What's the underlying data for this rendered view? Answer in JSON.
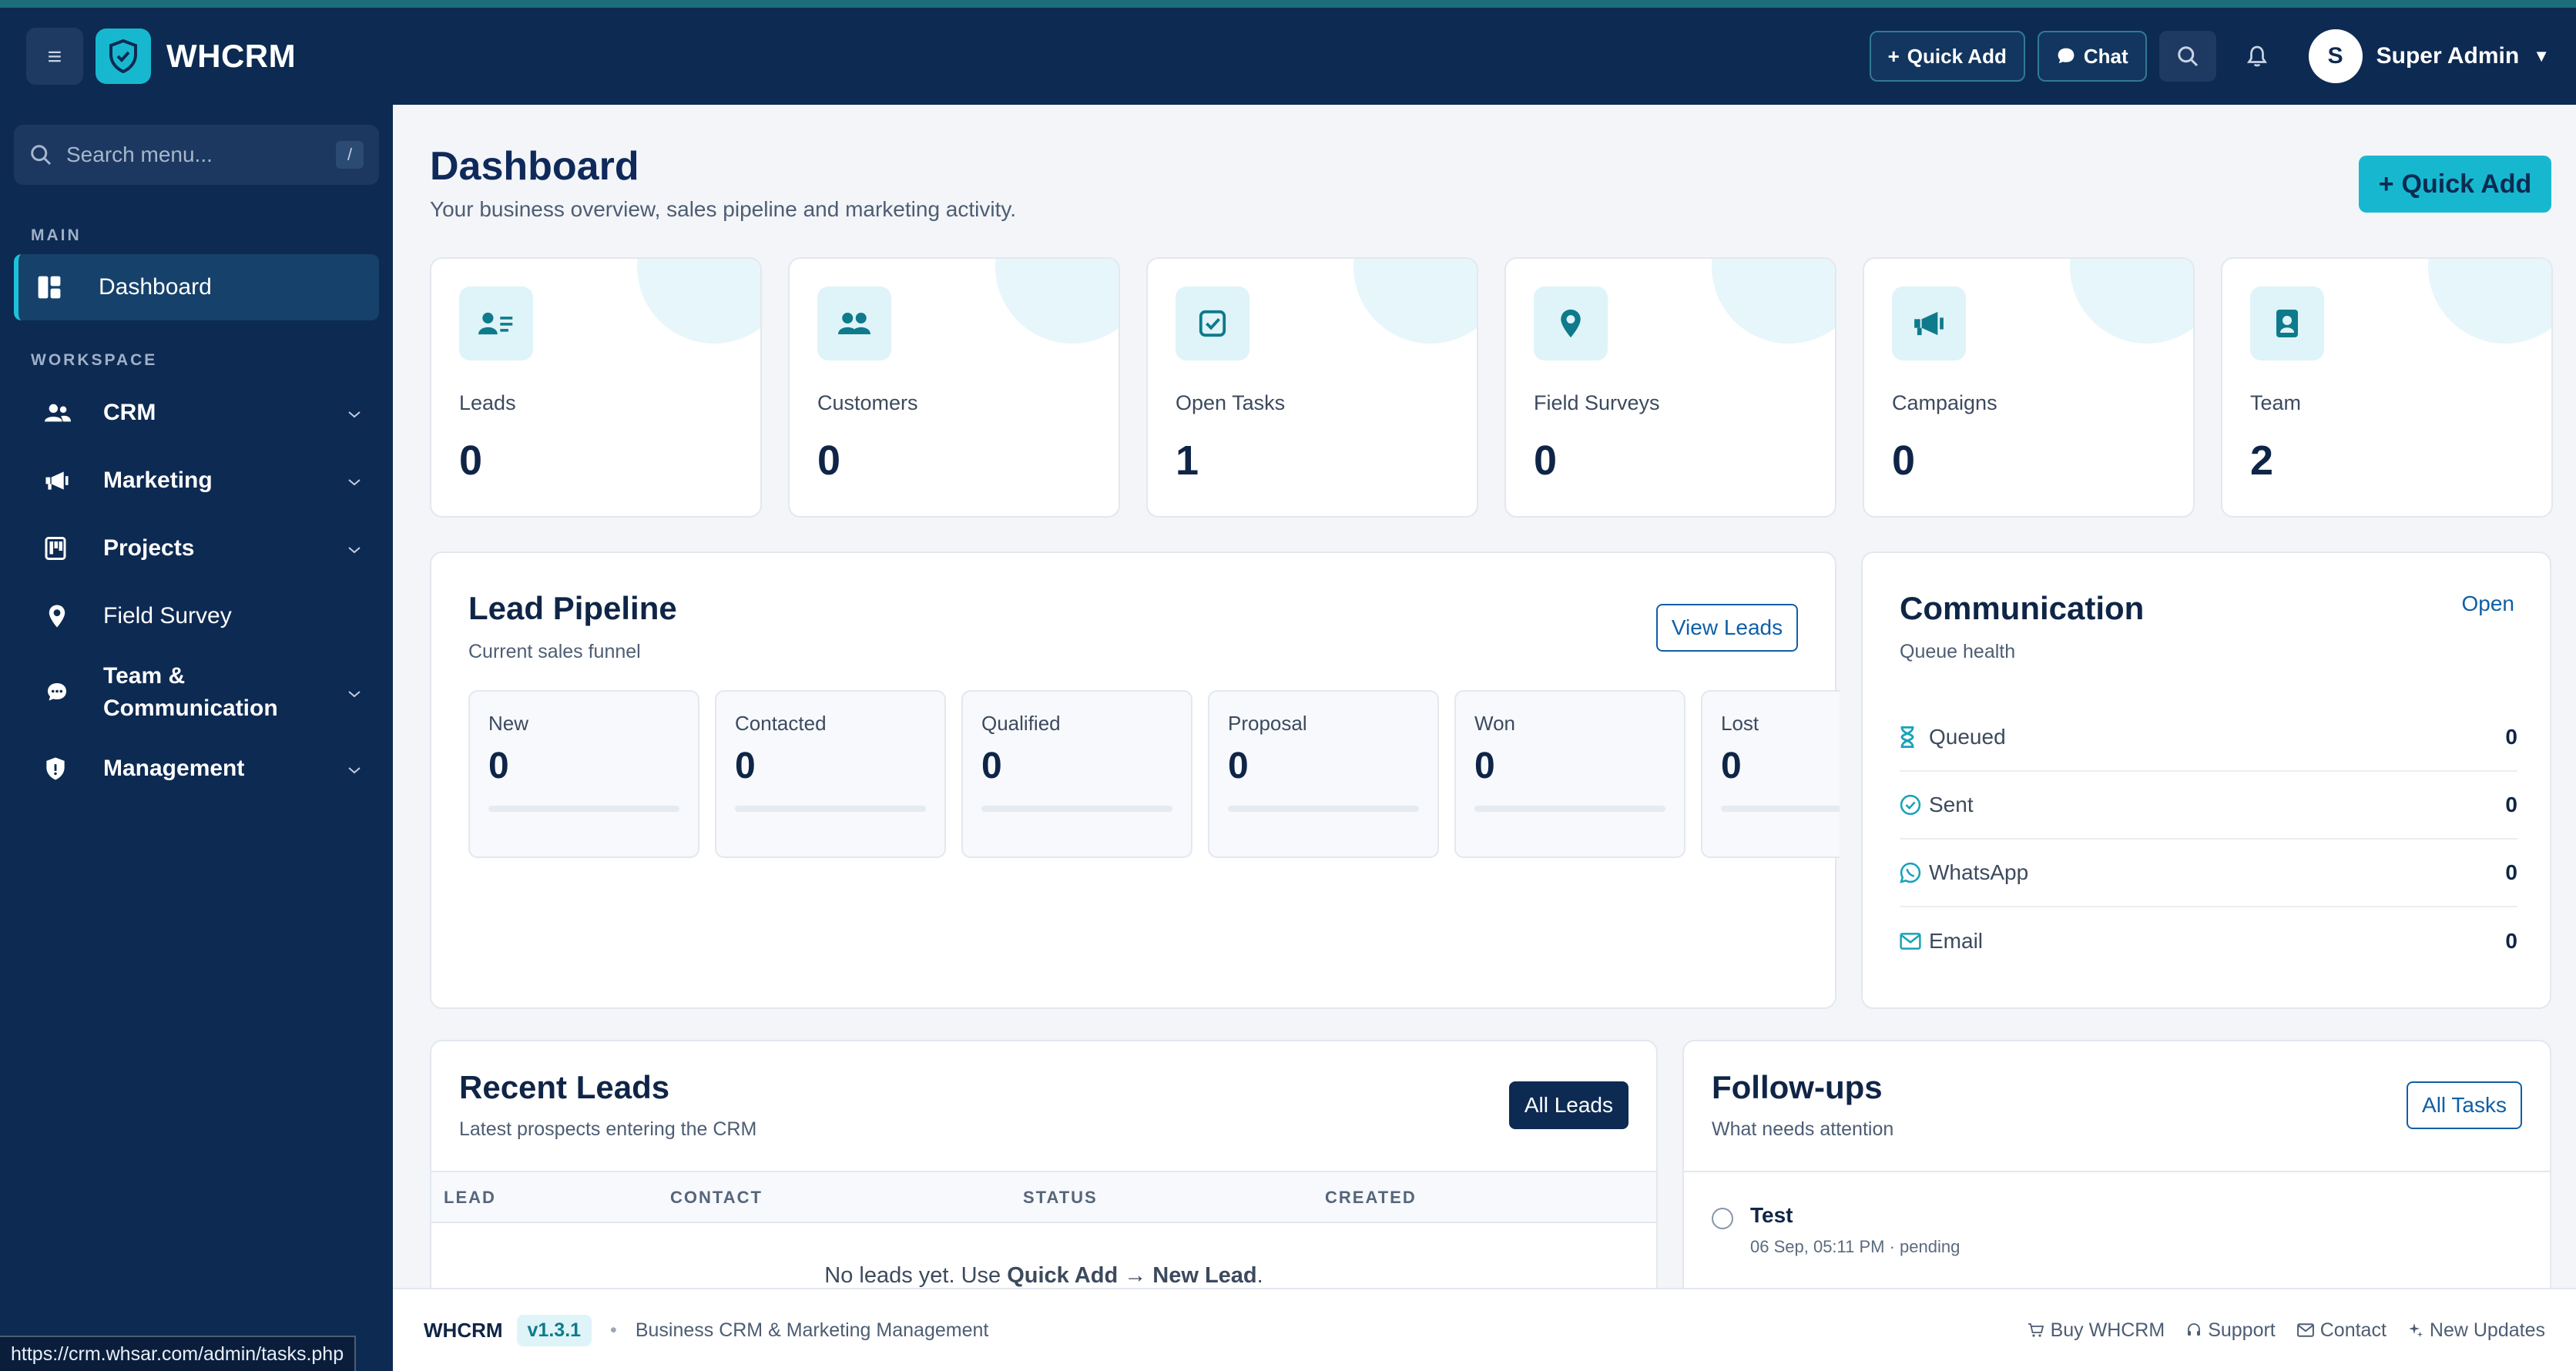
{
  "app": {
    "brand": "WHCRM",
    "accent_color": "#17b8cf",
    "nav_bg": "#0d2a52"
  },
  "topbar": {
    "quick_add": "Quick Add",
    "chat": "Chat",
    "user_initial": "S",
    "user_name": "Super Admin"
  },
  "sidebar": {
    "search_placeholder": "Search menu...",
    "search_shortcut": "/",
    "section_main": "MAIN",
    "section_workspace": "WORKSPACE",
    "items": [
      {
        "label": "Dashboard",
        "icon": "dashboard-icon",
        "active": true
      },
      {
        "label": "CRM",
        "icon": "users-icon"
      },
      {
        "label": "Marketing",
        "icon": "megaphone-icon"
      },
      {
        "label": "Projects",
        "icon": "kanban-icon"
      },
      {
        "label": "Field Survey",
        "icon": "map-pin-icon"
      },
      {
        "label_line1": "Team &",
        "label_line2": "Communication",
        "icon": "chat-icon"
      },
      {
        "label": "Management",
        "icon": "shield-icon"
      }
    ]
  },
  "page": {
    "title": "Dashboard",
    "subtitle": "Your business overview, sales pipeline and marketing activity.",
    "quick_add": "Quick Add"
  },
  "stats": [
    {
      "label": "Leads",
      "value": "0",
      "icon": "lead-card-icon"
    },
    {
      "label": "Customers",
      "value": "0",
      "icon": "users-icon"
    },
    {
      "label": "Open Tasks",
      "value": "1",
      "icon": "checkbox-icon"
    },
    {
      "label": "Field Surveys",
      "value": "0",
      "icon": "map-pin-icon"
    },
    {
      "label": "Campaigns",
      "value": "0",
      "icon": "megaphone-icon"
    },
    {
      "label": "Team",
      "value": "2",
      "icon": "id-badge-icon"
    }
  ],
  "pipeline": {
    "title": "Lead Pipeline",
    "subtitle": "Current sales funnel",
    "button": "View Leads",
    "stages": [
      {
        "label": "New",
        "value": "0"
      },
      {
        "label": "Contacted",
        "value": "0"
      },
      {
        "label": "Qualified",
        "value": "0"
      },
      {
        "label": "Proposal",
        "value": "0"
      },
      {
        "label": "Won",
        "value": "0"
      },
      {
        "label": "Lost",
        "value": "0"
      }
    ]
  },
  "communication": {
    "title": "Communication",
    "subtitle": "Queue health",
    "link": "Open",
    "rows": [
      {
        "label": "Queued",
        "value": "0",
        "icon": "hourglass-icon"
      },
      {
        "label": "Sent",
        "value": "0",
        "icon": "check-circle-icon"
      },
      {
        "label": "WhatsApp",
        "value": "0",
        "icon": "whatsapp-icon"
      },
      {
        "label": "Email",
        "value": "0",
        "icon": "envelope-icon"
      }
    ]
  },
  "recent_leads": {
    "title": "Recent Leads",
    "subtitle": "Latest prospects entering the CRM",
    "button": "All Leads",
    "columns": [
      "LEAD",
      "CONTACT",
      "STATUS",
      "CREATED"
    ],
    "empty_prefix": "No leads yet. Use ",
    "empty_bold": "Quick Add → New Lead",
    "empty_suffix": "."
  },
  "followups": {
    "title": "Follow-ups",
    "subtitle": "What needs attention",
    "button": "All Tasks",
    "items": [
      {
        "title": "Test",
        "meta": "06 Sep, 05:11 PM · pending"
      }
    ]
  },
  "footer": {
    "brand": "WHCRM",
    "version": "v1.3.1",
    "tagline": "Business CRM & Marketing Management",
    "links": [
      "Buy WHCRM",
      "Support",
      "Contact",
      "New Updates"
    ]
  },
  "status_url": "https://crm.whsar.com/admin/tasks.php"
}
